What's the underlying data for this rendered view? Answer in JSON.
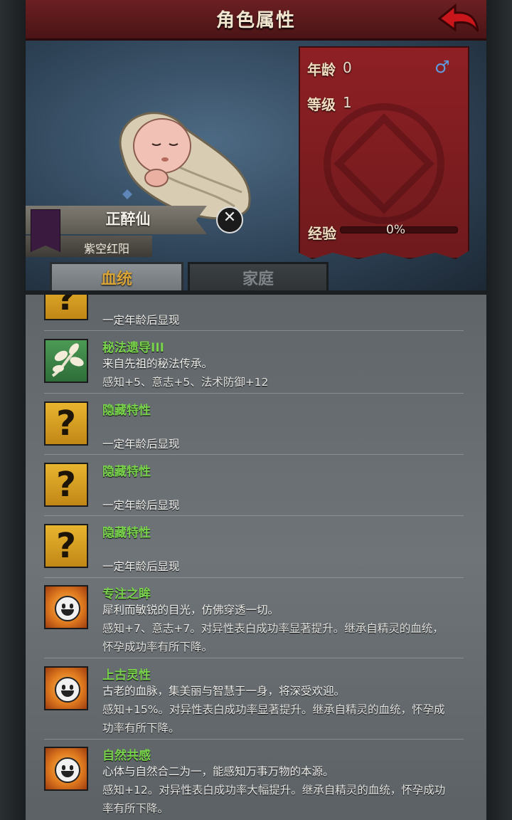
{
  "header": {
    "title": "角色属性"
  },
  "character": {
    "name": "正醉仙",
    "subtitle": "紫空红阳",
    "age_label": "年龄",
    "age_value": "0",
    "gender_symbol": "♂",
    "level_label": "等级",
    "level_value": "1",
    "xp_label": "经验",
    "xp_value": "0%",
    "xp_fraction": 0.0
  },
  "tabs": [
    {
      "label": "血统",
      "active": true
    },
    {
      "label": "家庭",
      "active": false
    }
  ],
  "traits": [
    {
      "icon": "question-icon",
      "name": "",
      "lines": [
        "一定年龄后显现"
      ],
      "partial": true
    },
    {
      "icon": "leaf-icon",
      "name": "秘法遗导III",
      "lines": [
        "来自先祖的秘法传承。",
        "感知+5、意志+5、法术防御+12"
      ]
    },
    {
      "icon": "question-icon",
      "name": "隐藏特性",
      "lines": [
        "",
        "一定年龄后显现"
      ]
    },
    {
      "icon": "question-icon",
      "name": "隐藏特性",
      "lines": [
        "",
        "一定年龄后显现"
      ]
    },
    {
      "icon": "question-icon",
      "name": "隐藏特性",
      "lines": [
        "",
        "一定年龄后显现"
      ]
    },
    {
      "icon": "smiley-sun-icon",
      "name": "专注之眸",
      "lines": [
        "犀利而敏锐的目光，仿佛穿透一切。",
        "感知+7、意志+7。对异性表白成功率显著提升。继承自精灵的血统，",
        "怀孕成功率有所下降。"
      ]
    },
    {
      "icon": "smiley-sun-icon",
      "name": "上古灵性",
      "lines": [
        "古老的血脉，集美丽与智慧于一身，将深受欢迎。",
        "感知+15%。对异性表白成功率显著提升。继承自精灵的血统，怀孕成",
        "功率有所下降。"
      ]
    },
    {
      "icon": "smiley-sun-icon",
      "name": "自然共感",
      "lines": [
        "心体与自然合二为一，能感知万事万物的本源。",
        "感知+12。对异性表白成功率大幅提升。继承自精灵的血统，怀孕成功",
        "率有所下降。"
      ]
    }
  ]
}
